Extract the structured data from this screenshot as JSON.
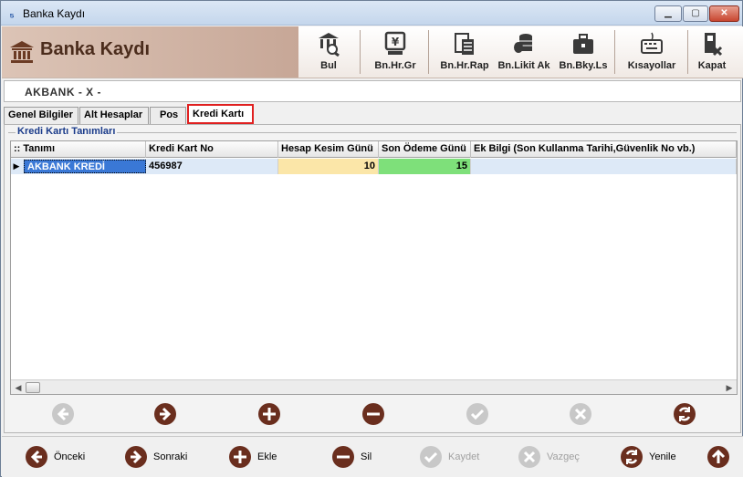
{
  "window": {
    "title": "Banka Kaydı",
    "min_label": "▁",
    "max_label": "▢",
    "close_label": "✕"
  },
  "header": {
    "title": "Banka Kaydı",
    "buttons": [
      {
        "label": "Bul",
        "icon": "bank-search-icon"
      },
      {
        "label": "Bn.Hr.Gr",
        "icon": "bank-entry-icon"
      },
      {
        "label": "Bn.Hr.Rap",
        "icon": "report-icon"
      },
      {
        "label": "Bn.Likit Ak",
        "icon": "coins-icon"
      },
      {
        "label": "Bn.Bky.Ls",
        "icon": "briefcase-icon"
      },
      {
        "label": "Kısayollar",
        "icon": "keyboard-icon"
      },
      {
        "label": "Kapat",
        "icon": "close-document-icon"
      }
    ]
  },
  "context": {
    "text": "AKBANK  -  X  -"
  },
  "tabs": [
    {
      "label": "Genel Bilgiler",
      "active": false
    },
    {
      "label": "Alt Hesaplar",
      "active": false
    },
    {
      "label": "Pos",
      "active": false
    },
    {
      "label": "Kredi Kartı",
      "active": true
    }
  ],
  "panel": {
    "title": "Kredi Kartı Tanımları"
  },
  "grid": {
    "columns": [
      {
        "label": ":: Tanımı"
      },
      {
        "label": "Kredi Kart No"
      },
      {
        "label": "Hesap Kesim Günü"
      },
      {
        "label": "Son Ödeme Günü"
      },
      {
        "label": "Ek Bilgi (Son Kullanma Tarihi,Güvenlik No vb.)"
      }
    ],
    "rows": [
      {
        "tanimi": "AKBANK KREDİ",
        "kart_no": "456987",
        "hesap_kesim": "10",
        "son_odeme": "15",
        "ek_bilgi": ""
      }
    ],
    "colors": {
      "selected_cell": "#3a78d6",
      "hesap_kesim_bg": "#fbe6a8",
      "son_odeme_bg": "#7ee07a",
      "row_bg": "#dde9f7"
    }
  },
  "bottom": {
    "buttons": [
      {
        "label": "Önceki",
        "icon": "arrow-left-icon",
        "enabled": true
      },
      {
        "label": "Sonraki",
        "icon": "arrow-right-icon",
        "enabled": true
      },
      {
        "label": "Ekle",
        "icon": "plus-icon",
        "enabled": true
      },
      {
        "label": "Sil",
        "icon": "minus-icon",
        "enabled": true
      },
      {
        "label": "Kaydet",
        "icon": "check-icon",
        "enabled": false
      },
      {
        "label": "Vazgeç",
        "icon": "x-icon",
        "enabled": false
      },
      {
        "label": "Yenile",
        "icon": "refresh-icon",
        "enabled": true
      }
    ]
  }
}
